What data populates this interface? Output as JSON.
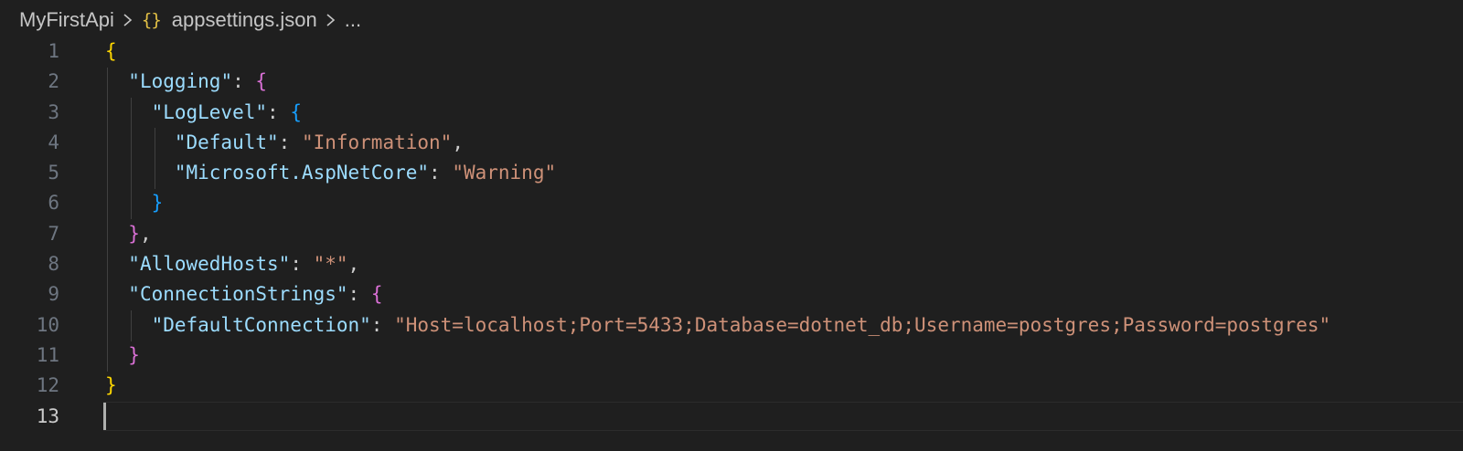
{
  "breadcrumb": {
    "project": "MyFirstApi",
    "file_icon": "{}",
    "file": "appsettings.json",
    "more": "..."
  },
  "editor": {
    "active_line": 13,
    "lines": [
      {
        "n": "1",
        "segments": [
          {
            "t": "{",
            "c": "b1"
          }
        ]
      },
      {
        "n": "2",
        "segments": [
          {
            "t": "  "
          },
          {
            "t": "\"Logging\"",
            "c": "k"
          },
          {
            "t": ": ",
            "c": "p"
          },
          {
            "t": "{",
            "c": "b2"
          }
        ]
      },
      {
        "n": "3",
        "segments": [
          {
            "t": "    "
          },
          {
            "t": "\"LogLevel\"",
            "c": "k"
          },
          {
            "t": ": ",
            "c": "p"
          },
          {
            "t": "{",
            "c": "b3"
          }
        ]
      },
      {
        "n": "4",
        "segments": [
          {
            "t": "      "
          },
          {
            "t": "\"Default\"",
            "c": "k"
          },
          {
            "t": ": ",
            "c": "p"
          },
          {
            "t": "\"Information\"",
            "c": "s"
          },
          {
            "t": ",",
            "c": "p"
          }
        ]
      },
      {
        "n": "5",
        "segments": [
          {
            "t": "      "
          },
          {
            "t": "\"Microsoft.AspNetCore\"",
            "c": "k"
          },
          {
            "t": ": ",
            "c": "p"
          },
          {
            "t": "\"Warning\"",
            "c": "s"
          }
        ]
      },
      {
        "n": "6",
        "segments": [
          {
            "t": "    "
          },
          {
            "t": "}",
            "c": "b3"
          }
        ]
      },
      {
        "n": "7",
        "segments": [
          {
            "t": "  "
          },
          {
            "t": "}",
            "c": "b2"
          },
          {
            "t": ",",
            "c": "p"
          }
        ]
      },
      {
        "n": "8",
        "segments": [
          {
            "t": "  "
          },
          {
            "t": "\"AllowedHosts\"",
            "c": "k"
          },
          {
            "t": ": ",
            "c": "p"
          },
          {
            "t": "\"*\"",
            "c": "s"
          },
          {
            "t": ",",
            "c": "p"
          }
        ]
      },
      {
        "n": "9",
        "segments": [
          {
            "t": "  "
          },
          {
            "t": "\"ConnectionStrings\"",
            "c": "k"
          },
          {
            "t": ": ",
            "c": "p"
          },
          {
            "t": "{",
            "c": "b2"
          }
        ]
      },
      {
        "n": "10",
        "segments": [
          {
            "t": "    "
          },
          {
            "t": "\"DefaultConnection\"",
            "c": "k"
          },
          {
            "t": ": ",
            "c": "p"
          },
          {
            "t": "\"Host=localhost;Port=5433;Database=dotnet_db;Username=postgres;Password=postgres\"",
            "c": "s"
          }
        ]
      },
      {
        "n": "11",
        "segments": [
          {
            "t": "  "
          },
          {
            "t": "}",
            "c": "b2"
          }
        ]
      },
      {
        "n": "12",
        "segments": [
          {
            "t": "}",
            "c": "b1"
          }
        ]
      },
      {
        "n": "13",
        "segments": []
      }
    ]
  },
  "colors": {
    "background": "#1f1f1f",
    "key": "#9cdcfe",
    "string": "#ce9178",
    "bracket_level1": "#ffd700",
    "bracket_level2": "#da70d6",
    "bracket_level3": "#179fff",
    "line_number": "#6e7681"
  },
  "icons": {
    "separator": "chevron-right-icon",
    "file": "json-file-icon"
  }
}
